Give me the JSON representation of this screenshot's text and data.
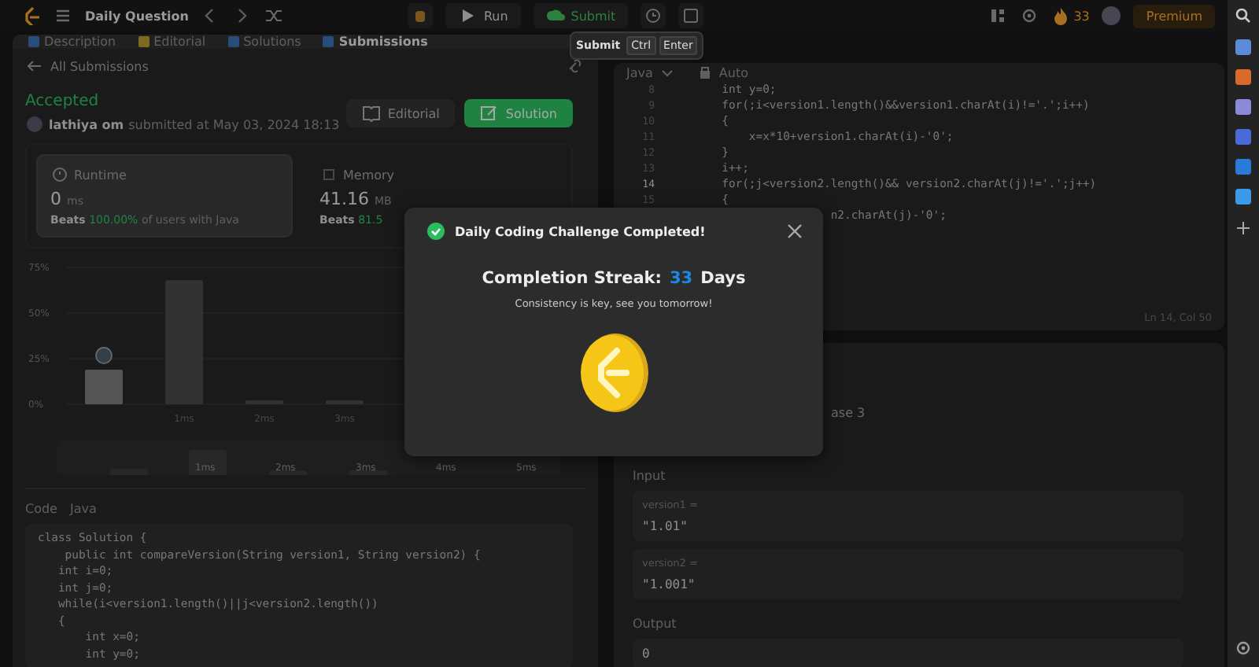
{
  "top_bar": {
    "title": "Daily Question",
    "run": "Run",
    "submit": "Submit",
    "streak": "33",
    "premium": "Premium"
  },
  "tooltip": {
    "label": "Submit",
    "keys": [
      "Ctrl",
      "Enter"
    ]
  },
  "left_panel": {
    "tabs": [
      {
        "label": "Description",
        "selected": false
      },
      {
        "label": "Editorial",
        "selected": false
      },
      {
        "label": "Solutions",
        "selected": false
      },
      {
        "label": "Submissions",
        "selected": true
      }
    ],
    "back_link": "All Submissions",
    "result": {
      "status": "Accepted",
      "user": "lathiya om",
      "submitted": "submitted at May 03, 2024 18:13"
    },
    "buttons": [
      {
        "kind": "editorial",
        "label": "Editorial"
      },
      {
        "kind": "solution",
        "label": "Solution"
      }
    ],
    "stats": [
      {
        "label": "Runtime",
        "value": "0",
        "unit": "ms",
        "beats": "Beats",
        "percent": "100.00%",
        "rest": "of users with Java",
        "selected": true
      },
      {
        "label": "Memory",
        "value": "41.16",
        "unit": "MB",
        "beats": "Beats",
        "percent": "81.5",
        "selected": false
      }
    ],
    "chart_data": {
      "type": "bar",
      "categories": [
        null,
        "1ms",
        "2ms",
        "3ms"
      ],
      "values": [
        19,
        68,
        1,
        1
      ],
      "ylim": [
        0,
        75
      ],
      "yticks": [
        {
          "value": 0,
          "label": "0%"
        },
        {
          "value": 25,
          "label": "25%"
        },
        {
          "value": 50,
          "label": "50%"
        },
        {
          "value": 75,
          "label": "75%"
        }
      ]
    },
    "range_labels": [
      "1ms",
      "2ms",
      "3ms",
      "4ms",
      "5ms"
    ],
    "code": {
      "label": "Code",
      "language": "Java",
      "lines": [
        "class Solution {",
        "    public int compareVersion(String version1, String version2) {",
        "   int i=0;",
        "   int j=0;",
        "   while(i<version1.length()||j<version2.length())",
        "   {",
        "       int x=0;",
        "       int y=0;"
      ]
    }
  },
  "editor": {
    "language": "Java",
    "mode": "Auto",
    "lines": [
      {
        "num": "8",
        "code": "        int y=0;"
      },
      {
        "num": "9",
        "code": "        for(;i<version1.length()&&version1.charAt(i)!='.';i++)"
      },
      {
        "num": "10",
        "code": "        {"
      },
      {
        "num": "11",
        "code": "            x=x*10+version1.charAt(i)-'0';"
      },
      {
        "num": "12",
        "code": "        }"
      },
      {
        "num": "13",
        "code": "        i++;"
      },
      {
        "num": "14",
        "code": "        for(;j<version2.length()&& version2.charAt(j)!='.';j++)"
      },
      {
        "num": "15",
        "code": "        {"
      },
      {
        "code": "                        n2.charAt(j)-'0';"
      }
    ],
    "cursor": "Ln 14, Col 50"
  },
  "testcase": {
    "tab": "ase 3",
    "input_label": "Input",
    "inputs": [
      {
        "name": "version1 =",
        "value": "\"1.01\""
      },
      {
        "name": "version2 =",
        "value": "\"1.001\""
      }
    ],
    "output_label": "Output",
    "output": "0"
  },
  "modal": {
    "title": "Daily Coding Challenge Completed!",
    "streak_label": "Completion Streak:",
    "streak": "33",
    "streak_unit": "Days",
    "message": "Consistency is key, see you tomorrow!"
  }
}
